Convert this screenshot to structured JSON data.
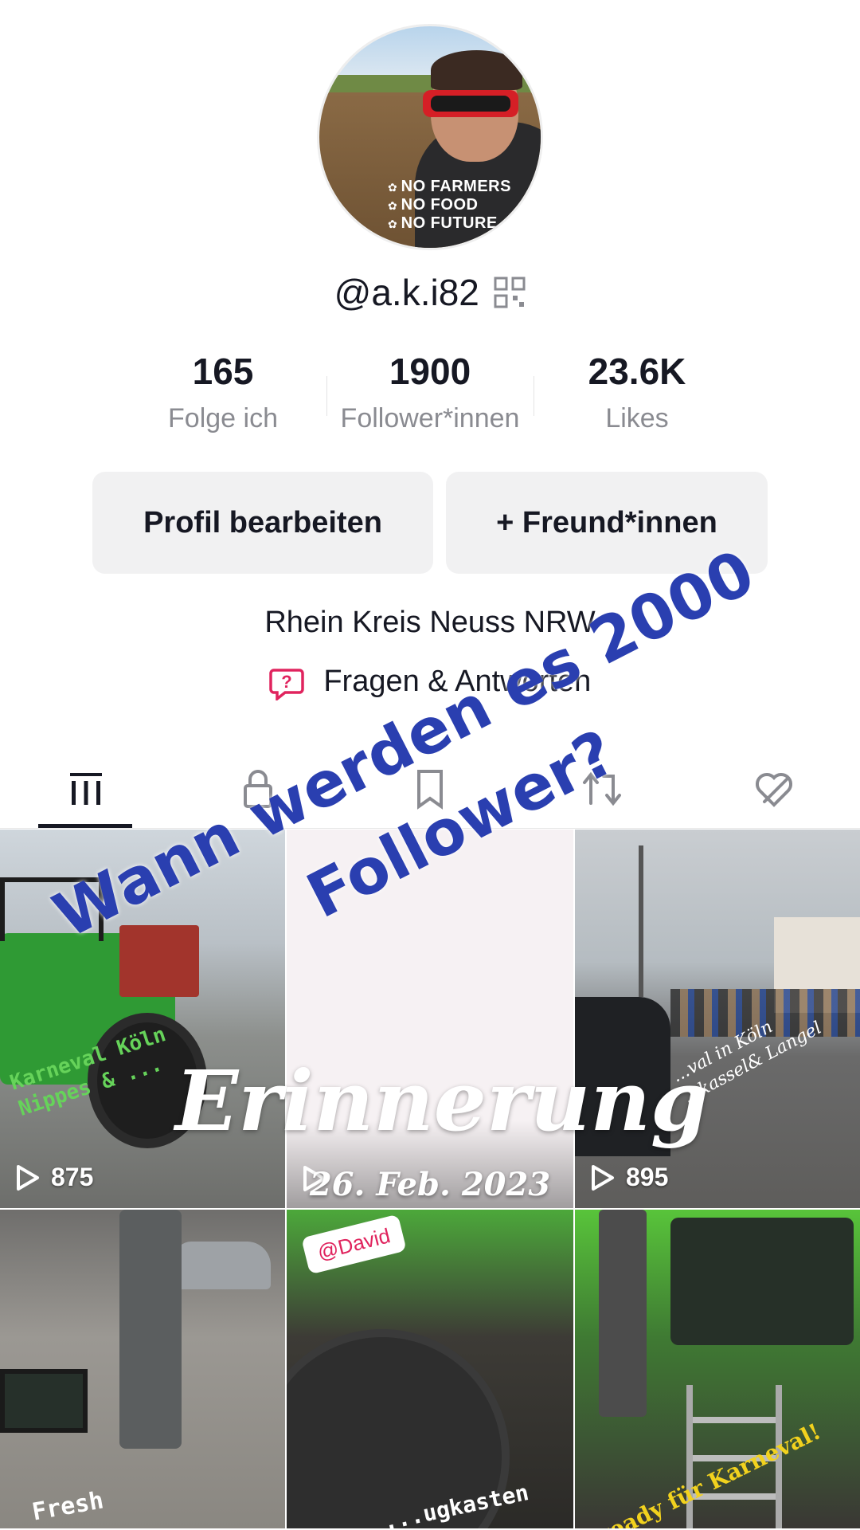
{
  "profile": {
    "avatar_slogan": [
      "NO FARMERS",
      "NO FOOD",
      "NO FUTURE"
    ],
    "username": "@a.k.i82",
    "qr_icon": "qr-code-icon"
  },
  "stats": [
    {
      "value": "165",
      "label": "Folge ich"
    },
    {
      "value": "1900",
      "label": "Follower*innen"
    },
    {
      "value": "23.6K",
      "label": "Likes"
    }
  ],
  "actions": {
    "edit_label": "Profil bearbeiten",
    "friends_label": "+ Freund*innen"
  },
  "bio": {
    "location": "Rhein Kreis Neuss NRW",
    "qa_label": "Fragen & Antworten",
    "qa_icon": "question-bubble-icon"
  },
  "tabs": [
    {
      "icon": "videos-grid-icon",
      "active": true
    },
    {
      "icon": "lock-icon",
      "active": false
    },
    {
      "icon": "bookmark-icon",
      "active": false
    },
    {
      "icon": "repost-icon",
      "active": false
    },
    {
      "icon": "liked-hidden-icon",
      "active": false
    }
  ],
  "videos": [
    {
      "plays": "875",
      "caption": [
        "Karneval Köln",
        "Nippes & ..."
      ]
    },
    {
      "plays": "",
      "caption": []
    },
    {
      "plays": "895",
      "caption": [
        "...val in Köln",
        "...kassel& Langel"
      ]
    },
    {
      "plays": "",
      "caption": [
        "Fresh"
      ]
    },
    {
      "plays": "",
      "caption": [
        "...ugkasten"
      ],
      "tag": "@David"
    },
    {
      "plays": "",
      "caption": [
        "ready für Karneval!"
      ]
    }
  ],
  "overlay": {
    "question_line1": "Wann werden es 2000",
    "question_line2": "Follower?",
    "memory_title": "Erinnerung",
    "memory_date": "26. Feb. 2023"
  },
  "colors": {
    "accent_blue": "#2a3fb0",
    "qa_pink": "#e0245e",
    "button_bg": "#f1f1f2",
    "text_secondary": "#8a8b91"
  }
}
